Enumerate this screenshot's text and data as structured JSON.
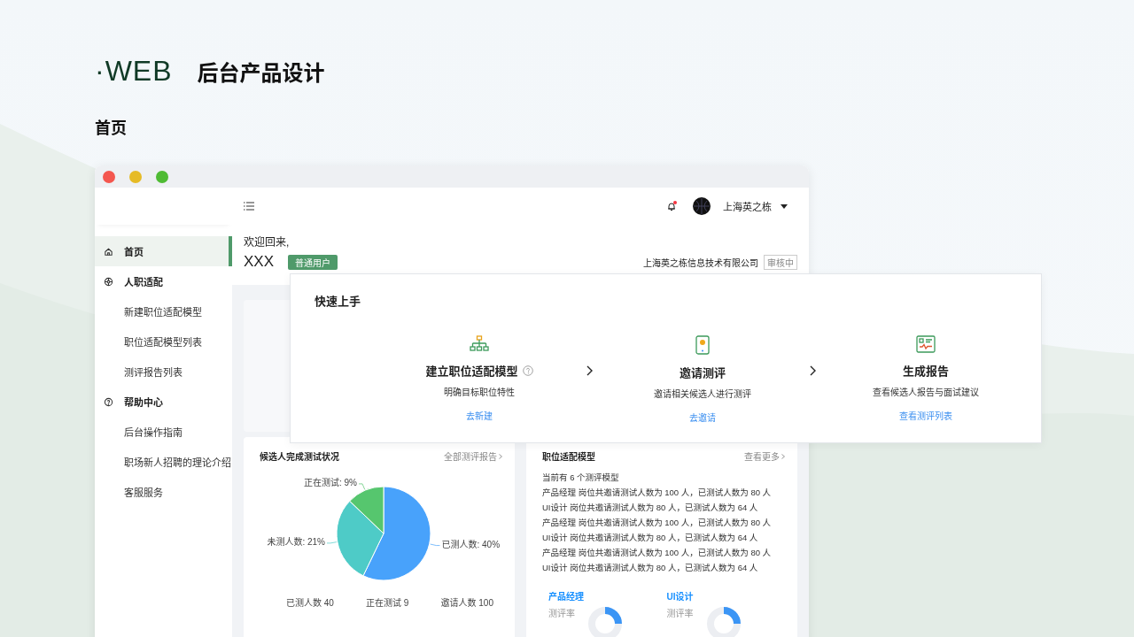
{
  "slide": {
    "brand": "·WEB",
    "title": "后台产品设计",
    "page_label": "首页"
  },
  "topbar": {
    "notification_unread": true,
    "user_name": "上海英之栋"
  },
  "sidebar": {
    "items": [
      {
        "label": "首页",
        "selected": true
      },
      {
        "label": "人职适配",
        "selected": false,
        "children": [
          {
            "label": "新建职位适配模型",
            "selected": false
          },
          {
            "label": "职位适配模型列表",
            "selected": false
          },
          {
            "label": "测评报告列表",
            "selected": false
          }
        ]
      },
      {
        "label": "帮助中心",
        "selected": false,
        "children": [
          {
            "label": "后台操作指南",
            "selected": false
          },
          {
            "label": "职场新人招聘的理论介绍",
            "selected": false
          },
          {
            "label": "客服服务",
            "selected": false
          }
        ]
      }
    ]
  },
  "welcome": {
    "greeting": "欢迎回来,",
    "name": "XXX",
    "role_badge": "普通用户",
    "company": "上海英之栋信息技术有限公司",
    "status_badge": "审核中"
  },
  "quick_start": {
    "title": "快速上手",
    "steps": [
      {
        "title": "建立职位适配模型",
        "help": true,
        "desc": "明确目标职位特性",
        "link": "去新建"
      },
      {
        "title": "邀请测评",
        "help": false,
        "desc": "邀请相关候选人进行测评",
        "link": "去邀请"
      },
      {
        "title": "生成报告",
        "help": false,
        "desc": "查看候选人报告与面试建议",
        "link": "查看测评列表"
      }
    ]
  },
  "completion_card": {
    "title": "候选人完成测试状况",
    "link": "全部测评报告",
    "chart_data": {
      "type": "pie",
      "values": [
        40,
        21,
        9
      ],
      "value_labels": [
        "已测人数: 40%",
        "未测人数: 21%",
        "正在测试: 9%"
      ]
    },
    "stats": [
      "已测人数 40",
      "正在测试 9",
      "邀请人数 100"
    ]
  },
  "models_card": {
    "title": "职位适配模型",
    "link": "查看更多",
    "lines": [
      "当前有 6 个测评模型",
      "产品经理 岗位共邀请测试人数为 100 人，已测试人数为 80 人",
      "UI设计 岗位共邀请测试人数为 80 人，已测试人数为 64 人",
      "产品经理 岗位共邀请测试人数为 100 人，已测试人数为 80 人",
      "UI设计 岗位共邀请测试人数为 80 人，已测试人数为 64 人",
      "产品经理 岗位共邀请测试人数为 100 人，已测试人数为 80 人",
      "UI设计 岗位共邀请测试人数为 80 人，已测试人数为 64 人"
    ],
    "groups": [
      {
        "title": "产品经理",
        "metric": "测评率"
      },
      {
        "title": "UI设计",
        "metric": "测评率"
      }
    ]
  }
}
